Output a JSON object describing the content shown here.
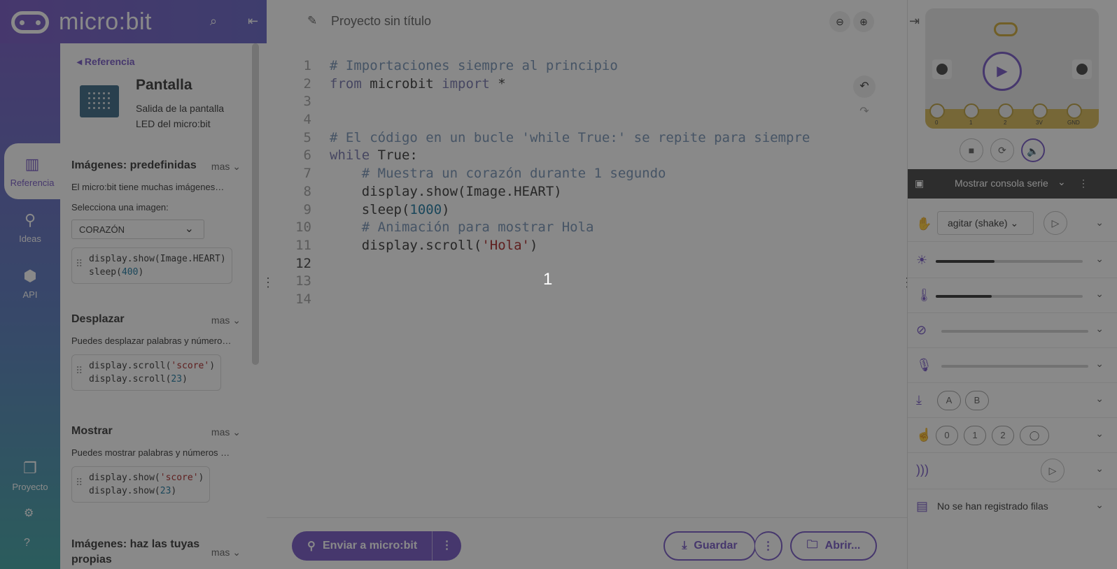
{
  "app": {
    "brand": "micro:bit"
  },
  "rail": {
    "items": [
      {
        "label": "Referencia",
        "icon": "books-icon"
      },
      {
        "label": "Ideas",
        "icon": "lightbulb-icon"
      },
      {
        "label": "API",
        "icon": "python-icon"
      }
    ],
    "project_label": "Proyecto"
  },
  "reference": {
    "back_label": "Referencia",
    "title": "Pantalla",
    "description": "Salida de la pantalla LED del micro:bit",
    "more_label": "mas",
    "sections": [
      {
        "title": "Imágenes: predefinidas",
        "desc": "El micro:bit tiene muchas imágenes…",
        "select_label": "Selecciona una imagen:",
        "select_value": "CORAZÓN",
        "code": [
          "display.show(Image.HEART)",
          "sleep(400)"
        ]
      },
      {
        "title": "Desplazar",
        "desc": "Puedes desplazar palabras y número…",
        "code": [
          "display.scroll('score')",
          "display.scroll(23)"
        ]
      },
      {
        "title": "Mostrar",
        "desc": "Puedes mostrar palabras y números …",
        "code": [
          "display.show('score')",
          "display.show(23)"
        ]
      },
      {
        "title": "Imágenes: haz las tuyas propias"
      }
    ]
  },
  "editor": {
    "project_name": "Proyecto sin título",
    "lines": [
      "# Importaciones siempre al principio",
      "from microbit import *",
      "",
      "",
      "# El código en un bucle 'while True:' se repite para siempre",
      "while True:",
      "    # Muestra un corazón durante 1 segundo",
      "    display.show(Image.HEART)",
      "    sleep(1000)",
      "    # Animación para mostrar Hola",
      "    display.scroll('Hola')",
      "",
      "",
      ""
    ],
    "line_numbers": [
      "1",
      "2",
      "3",
      "4",
      "5",
      "6",
      "7",
      "8",
      "9",
      "10",
      "11",
      "12",
      "13",
      "14"
    ],
    "countdown": "1"
  },
  "toolbar": {
    "send_label": "Enviar a micro:bit",
    "save_label": "Guardar",
    "open_label": "Abrir..."
  },
  "simulator": {
    "pins": [
      "0",
      "1",
      "2",
      "3V",
      "GND"
    ],
    "serial_label": "Mostrar consola serie",
    "gesture_value": "agitar (shake)",
    "buttons": [
      "A",
      "B"
    ],
    "touch_pins": [
      "0",
      "1",
      "2"
    ],
    "light_level": 0.4,
    "temperature_level": 0.38,
    "data_log_label": "No se han registrado filas"
  }
}
